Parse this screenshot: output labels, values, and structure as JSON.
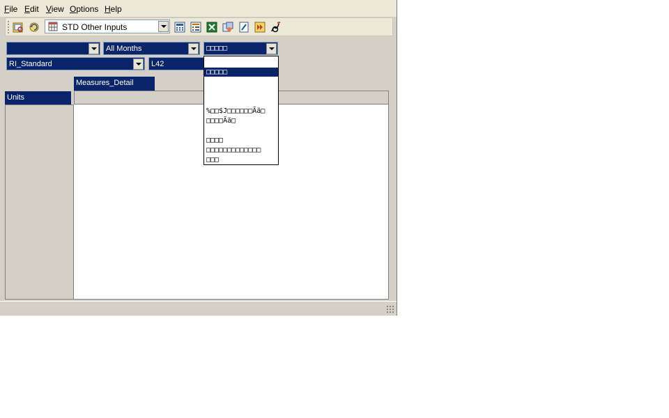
{
  "menu": {
    "items": [
      {
        "label": "File",
        "accel": "F",
        "rest": "ile"
      },
      {
        "label": "Edit",
        "accel": "E",
        "rest": "dit"
      },
      {
        "label": "View",
        "accel": "V",
        "rest": "iew"
      },
      {
        "label": "Options",
        "accel": "O",
        "rest": "ptions"
      },
      {
        "label": "Help",
        "accel": "H",
        "rest": "elp"
      }
    ]
  },
  "toolbar": {
    "view_selector": "STD Other Inputs",
    "icons": [
      "open-icon",
      "refresh-icon",
      "calculator-icon",
      "form-icon",
      "excel-icon",
      "export-icon",
      "edit-note-icon",
      "forward-icon",
      "signature-icon"
    ]
  },
  "filters": {
    "row1": {
      "combo1": "",
      "combo2": "All Months",
      "combo3": "□□□□□"
    },
    "row2": {
      "combo1": "RI_Standard",
      "combo2": "L42"
    }
  },
  "grid": {
    "column_dimension": "Measures_Detail",
    "row_dimension": "Units"
  },
  "dropdown": {
    "options": [
      {
        "text": "",
        "selected": false
      },
      {
        "text": "□□□□□",
        "selected": true
      },
      {
        "text": "",
        "selected": false
      },
      {
        "text": "",
        "selected": false
      },
      {
        "text": "",
        "selected": false
      },
      {
        "text": "%□□$J□□□□□□Ãã□",
        "selected": false
      },
      {
        "text": "□□□□Ãã□",
        "selected": false
      },
      {
        "text": "",
        "selected": false
      },
      {
        "text": "□□□□",
        "selected": false
      },
      {
        "text": "□□□□□□□□□□□□□",
        "selected": false
      },
      {
        "text": "□□□",
        "selected": false
      }
    ]
  },
  "colors": {
    "selection": "#0a246a",
    "window_bg": "#d4d0c8",
    "menubar_bg": "#ece9d8"
  }
}
